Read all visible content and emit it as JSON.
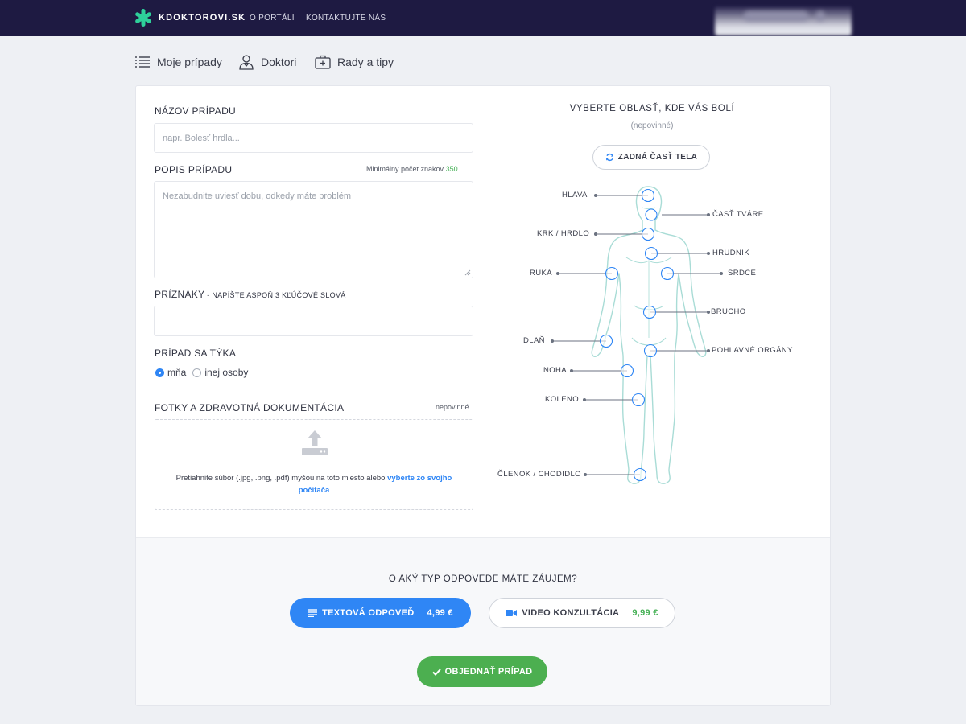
{
  "header": {
    "brand": "KDOKTOROVI.SK",
    "nav": [
      "O PORTÁLI",
      "KONTAKTUJTE NÁS"
    ]
  },
  "subnav": {
    "cases": "Moje prípady",
    "doctors": "Doktori",
    "tips": "Rady a tipy"
  },
  "form": {
    "title_label": "NÁZOV PRÍPADU",
    "title_placeholder": "napr. Bolesť hrdla...",
    "desc_label": "POPIS PRÍPADU",
    "desc_hint": "Minimálny počet znakov",
    "desc_min": "350",
    "desc_placeholder": "Nezabudnite uviesť dobu, odkedy máte problém",
    "symptoms_label": "PRÍZNAKY",
    "symptoms_sub": " - NAPÍŠTE ASPOŇ 3 KĽÚČOVÉ SLOVÁ",
    "concerns_label": "PRÍPAD SA TÝKA",
    "radio_me": "mňa",
    "radio_other": "inej osoby",
    "photos_label": "FOTKY A ZDRAVOTNÁ DOKUMENTÁCIA",
    "photos_optional": "nepovinné",
    "drop_text": "Pretiahnite súbor (.jpg, .png, .pdf) myšou na toto miesto alebo ",
    "drop_link": "vyberte zo svojho počítača"
  },
  "bodymap": {
    "title": "VYBERTE OBLASŤ, KDE VÁS BOLÍ",
    "subtitle": "(nepovinné)",
    "back_button": "ZADNÁ ČASŤ TELA",
    "labels": {
      "hlava": "HLAVA",
      "tvar": "ČASŤ TVÁRE",
      "krk": "KRK / HRDLO",
      "hrudnik": "HRUDNÍK",
      "ruka": "RUKA",
      "srdce": "SRDCE",
      "brucho": "BRUCHO",
      "dlan": "DLAŇ",
      "pohlavne": "POHLAVNÉ ORGÁNY",
      "noha": "NOHA",
      "koleno": "KOLENO",
      "clenok": "ČLENOK / CHODIDLO"
    }
  },
  "order": {
    "question": "O AKÝ TYP ODPOVEDE MÁTE ZÁUJEM?",
    "text_label": "TEXTOVÁ ODPOVEĎ",
    "text_price": "4,99 €",
    "video_label": "VIDEO KONZULTÁCIA",
    "video_price": "9,99 €",
    "submit": "OBJEDNAŤ PRÍPAD"
  },
  "colors": {
    "header_bg": "#1e1a42",
    "primary": "#2f86f5",
    "success": "#4caf50",
    "logo": "#2ecf9a"
  }
}
